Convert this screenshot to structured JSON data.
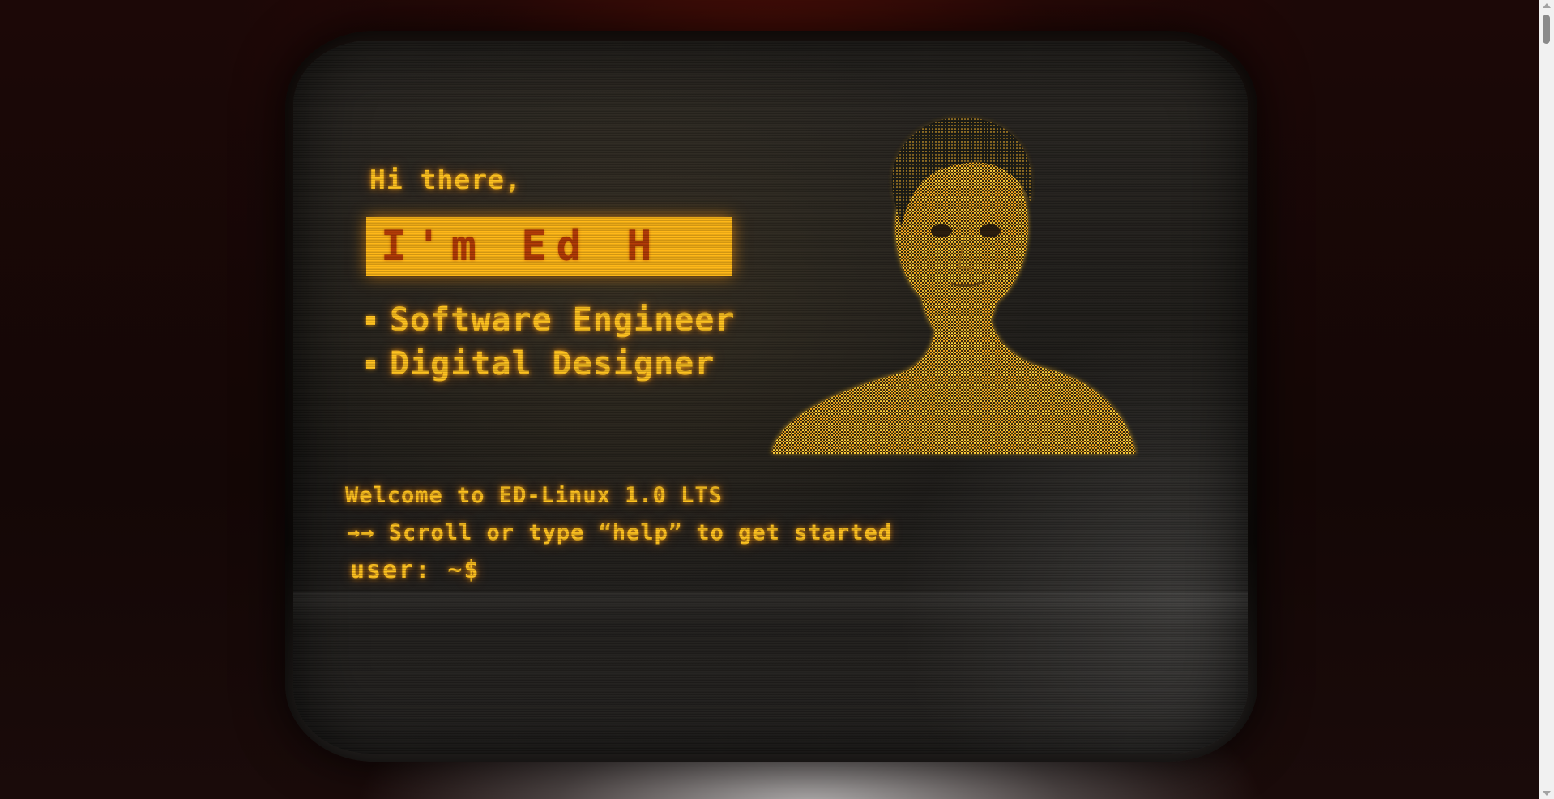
{
  "hero": {
    "greeting": "Hi there,",
    "name": "I'm Ed H",
    "roles": [
      "Software Engineer",
      "Digital Designer"
    ]
  },
  "terminal": {
    "welcome": "Welcome to ED-Linux 1.0 LTS",
    "hint": "→→ Scroll or type “help” to get started",
    "prompt": "user: ~$",
    "input_value": ""
  },
  "colors": {
    "phosphor": "#ffc21f",
    "highlight": "#ffb716",
    "name_text": "#b33a05",
    "screen": "#1d1b18"
  },
  "icons": {
    "portrait": "dithered-portrait-image",
    "bullet": "square-bullet-icon"
  }
}
